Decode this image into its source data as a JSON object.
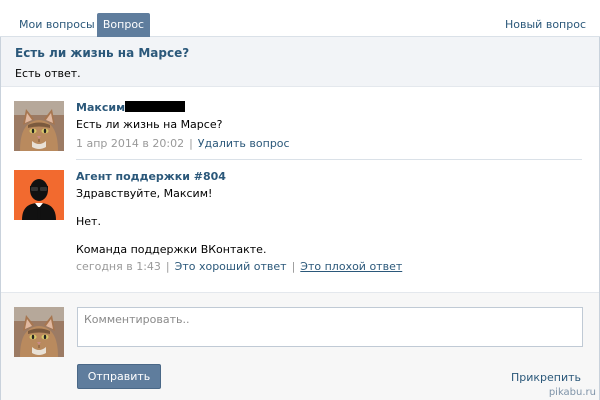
{
  "tabs": {
    "my_questions": "Мои вопросы",
    "question": "Вопрос",
    "new_question": "Новый вопрос"
  },
  "question": {
    "title": "Есть ли жизнь на Марсе?",
    "status": "Есть ответ."
  },
  "posts": [
    {
      "author": "Максим",
      "text": "Есть ли жизнь на Марсе?",
      "date": "1 апр 2014 в 20:02",
      "action": "Удалить вопрос"
    },
    {
      "author": "Агент поддержки #804",
      "greeting": "Здравствуйте, Максим!",
      "answer": "Нет.",
      "signature": "Команда поддержки ВКонтакте.",
      "date": "сегодня в 1:43",
      "good": "Это хороший ответ",
      "bad": "Это плохой ответ"
    }
  ],
  "comment": {
    "placeholder": "Комментировать..",
    "send": "Отправить",
    "attach": "Прикрепить"
  },
  "watermark": "pikabu.ru",
  "colors": {
    "accent": "#5f7d9d",
    "link": "#2b587a",
    "header_bg": "#f2f4f7",
    "agent_bg": "#f26a2f"
  },
  "icons": {
    "user_avatar": "cat-avatar-icon",
    "agent_avatar": "support-agent-icon"
  }
}
